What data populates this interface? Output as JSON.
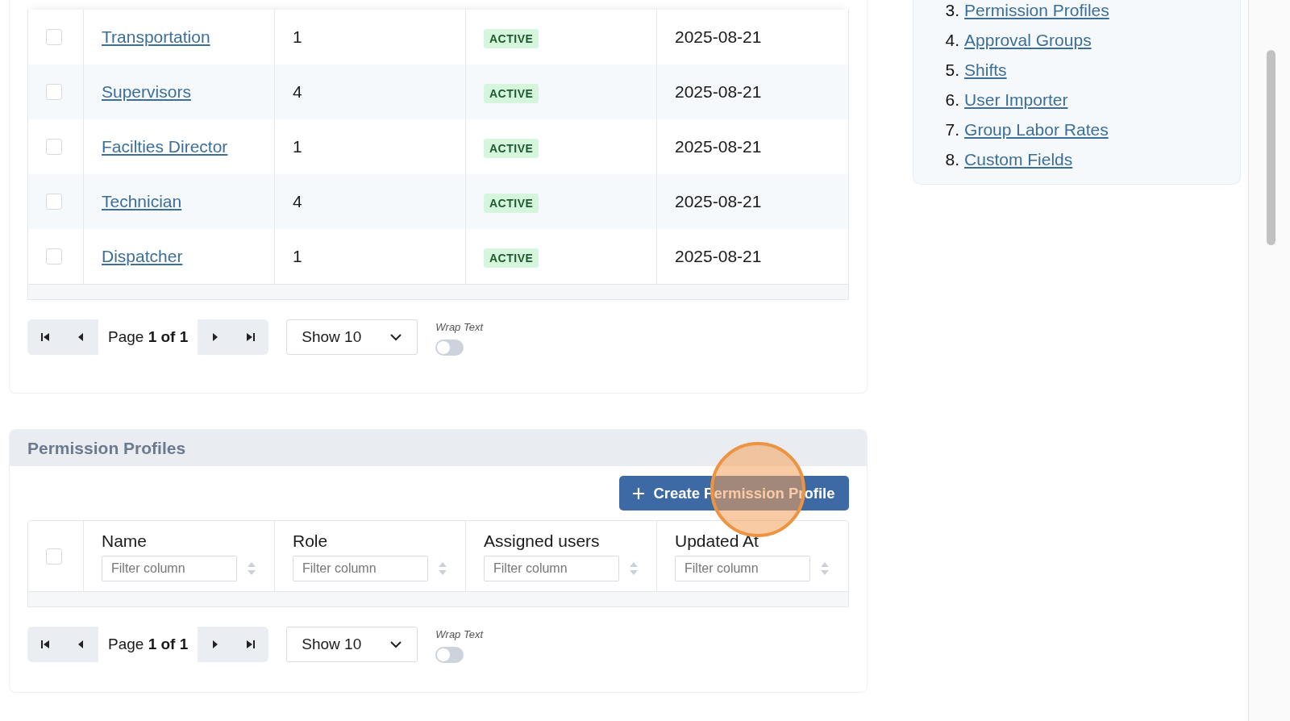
{
  "roles_table": {
    "rows": [
      {
        "name": "Transportation",
        "users": "1",
        "status": "ACTIVE",
        "updated": "2025-08-21",
        "checked": false
      },
      {
        "name": "Supervisors",
        "users": "4",
        "status": "ACTIVE",
        "updated": "2025-08-21",
        "checked": false
      },
      {
        "name": "Facilties Director",
        "users": "1",
        "status": "ACTIVE",
        "updated": "2025-08-21",
        "checked": false
      },
      {
        "name": "Technician",
        "users": "4",
        "status": "ACTIVE",
        "updated": "2025-08-21",
        "checked": false
      },
      {
        "name": "Dispatcher",
        "users": "1",
        "status": "ACTIVE",
        "updated": "2025-08-21",
        "checked": false
      }
    ],
    "pagination": {
      "page": "Page **1 of 1**",
      "page_size": "Show 10"
    },
    "wrap_text": {
      "label": "Wrap Text",
      "on": false
    }
  },
  "permission_profiles": {
    "title": "Permission Profiles",
    "create_button": "Create Permission Profile",
    "click_highlight": true,
    "columns": [
      {
        "label": "Name",
        "filter_placeholder": "Filter column"
      },
      {
        "label": "Role",
        "filter_placeholder": "Filter column"
      },
      {
        "label": "Assigned users",
        "filter_placeholder": "Filter column"
      },
      {
        "label": "Updated At",
        "filter_placeholder": "Filter column"
      }
    ],
    "select_all_checked": false,
    "pagination": {
      "page": "Page **1 of 1**",
      "page_size": "Show 10"
    },
    "wrap_text": {
      "label": "Wrap Text",
      "on": false
    }
  },
  "sidebar": {
    "items": [
      {
        "number": "3.",
        "label": "Permission Profiles"
      },
      {
        "number": "4.",
        "label": "Approval Groups"
      },
      {
        "number": "5.",
        "label": "Shifts"
      },
      {
        "number": "6.",
        "label": "User Importer"
      },
      {
        "number": "7.",
        "label": "Group Labor Rates"
      },
      {
        "number": "8.",
        "label": "Custom Fields"
      }
    ]
  }
}
